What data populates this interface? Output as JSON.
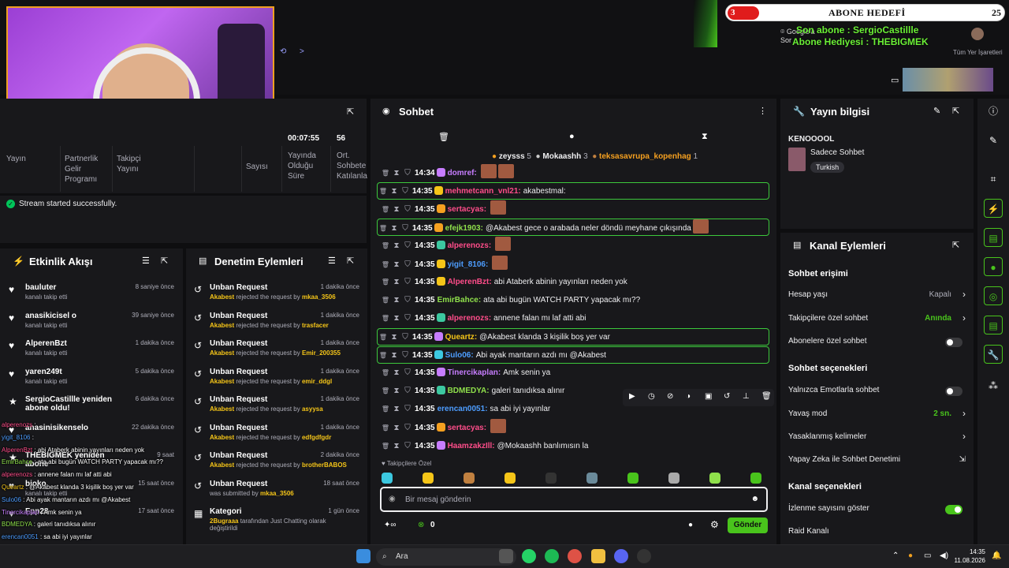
{
  "overlay": {
    "goal_current": "3",
    "goal_title": "ABONE HEDEFİ",
    "goal_target": "25",
    "last_sub": "Son abone : SergioCastillle",
    "gift_sub": "Abone Hediyesi : THEBIGMEK",
    "browser_search": "Google'a Sor",
    "bookmarks": "Tüm Yer İşaretleri"
  },
  "stats": {
    "partner_label": "Partnerlik Gelir Programı",
    "follow_label": "Takipçi Yayını",
    "live_label": "Yayında Olduğu Süre",
    "live_value": "00:07:55",
    "viewers_label": "Sayısı",
    "viewers_value": "56",
    "avg_label": "Ort. Sohbete Katılanla"
  },
  "notice": "Stream started successfully.",
  "activity": {
    "title": "Etkinlik Akışı",
    "items": [
      {
        "name": "bauluter",
        "sub": "kanalı takip etti",
        "time": "8 saniye önce"
      },
      {
        "name": "anasikicisel o",
        "sub": "kanalı takip etti",
        "time": "39 saniye önce"
      },
      {
        "name": "AlperenBzt",
        "sub": "kanalı takip etti",
        "time": "1 dakika önce"
      },
      {
        "name": "yaren249t",
        "sub": "kanalı takip etti",
        "time": "5 dakika önce"
      },
      {
        "name": "SergioCastillle yeniden abone oldu!",
        "sub": "",
        "time": "6 dakika önce"
      },
      {
        "name": "anasinisikenselo",
        "sub": "",
        "time": "22 dakika önce"
      },
      {
        "name": "THEBIGMEK yeniden abone",
        "sub": "",
        "time": "9 saat"
      },
      {
        "name": "bioko",
        "sub": "kanalı takip etti",
        "time": "15 saat önce"
      },
      {
        "name": "Fpp28",
        "sub": "",
        "time": "17 saat önce"
      }
    ]
  },
  "moderation": {
    "title": "Denetim Eylemleri",
    "items": [
      {
        "title": "Unban Request",
        "who": "Akabest",
        "text": "rejected the request by",
        "target": "mkaa_3506",
        "time": "1 dakika önce"
      },
      {
        "title": "Unban Request",
        "who": "Akabest",
        "text": "rejected the request by",
        "target": "trasfacer",
        "time": "1 dakika önce"
      },
      {
        "title": "Unban Request",
        "who": "Akabest",
        "text": "rejected the request by",
        "target": "Emir_200355",
        "time": "1 dakika önce"
      },
      {
        "title": "Unban Request",
        "who": "Akabest",
        "text": "rejected the request by",
        "target": "emir_ddgl",
        "time": "1 dakika önce"
      },
      {
        "title": "Unban Request",
        "who": "Akabest",
        "text": "rejected the request by",
        "target": "asyysa",
        "time": "1 dakika önce"
      },
      {
        "title": "Unban Request",
        "who": "Akabest",
        "text": "rejected the request by",
        "target": "edfgdfgdr",
        "time": "1 dakika önce"
      },
      {
        "title": "Unban Request",
        "who": "Akabest",
        "text": "rejected the request by",
        "target": "brotherBABOS",
        "time": "2 dakika önce"
      },
      {
        "title": "Unban Request",
        "who": "",
        "text": "was submitted by",
        "target": "mkaa_3506",
        "time": "18 saat önce"
      },
      {
        "title": "Kategori",
        "who": "2Bugraaa",
        "text": "tarafından Just Chatting olarak değiştirildi",
        "target": "",
        "time": "1 gün önce"
      }
    ]
  },
  "overlay_chat": [
    {
      "user": "alperenozs",
      "color": "#ff4d8a",
      "msg": ""
    },
    {
      "user": "yigit_8106",
      "color": "#4d9dff",
      "msg": ""
    },
    {
      "user": "AlperenBzt",
      "color": "#ff4d8a",
      "msg": "abi Atаberk abinin yayınları neden yok"
    },
    {
      "user": "EmirBahce",
      "color": "#8fe04b",
      "msg": "ata abi bugün WATCH PARTY yapacak mı??"
    },
    {
      "user": "alperenozs",
      "color": "#ff4d8a",
      "msg": "annene falan mı laf atti abi"
    },
    {
      "user": "Queartz",
      "color": "#f5c518",
      "msg": "@Akabest klanda 3 kişilik boş yer var"
    },
    {
      "user": "Sulo06",
      "color": "#4d9dff",
      "msg": "Abi ayak mantarın azdı mı @Akabest"
    },
    {
      "user": "Tinercikaplan",
      "color": "#c77dff",
      "msg": "Amk senin ya"
    },
    {
      "user": "BDMEDYA",
      "color": "#8fe04b",
      "msg": "galeri tanıdıksa alınır"
    },
    {
      "user": "erencan0051",
      "color": "#4d9dff",
      "msg": "sa abi iyi yayınlar"
    },
    {
      "user": "sertacyas",
      "color": "#ff4d8a",
      "msg": ""
    },
    {
      "user": "HaamzakzIll",
      "color": "#ff4d8a",
      "msg": "@Mokaashh banlımısın la"
    }
  ],
  "chat": {
    "title": "Sohbet",
    "top_users": [
      {
        "name": "zeysss",
        "count": "5"
      },
      {
        "name": "Mokaashh",
        "count": "3"
      },
      {
        "name": "teksasavrupa_kopenhag",
        "count": "1"
      }
    ],
    "messages": [
      {
        "time": "14:35",
        "user": "domref",
        "color": "#c77dff",
        "msg": "",
        "emotes": 2,
        "hl": false,
        "badge": "#c77dff"
      },
      {
        "time": "14:35",
        "user": "mehmetcann_vnl21",
        "color": "#ff4d8a",
        "msg": "akabestmal:",
        "emotes": 0,
        "hl": true,
        "badge": "#f5c518"
      },
      {
        "time": "14:35",
        "user": "sertacyas",
        "color": "#ff4d8a",
        "msg": "",
        "emotes": 1,
        "hl": false,
        "badge": "#f5a020"
      },
      {
        "time": "14:35",
        "user": "efejk1903",
        "color": "#8fe04b",
        "msg": "@Akabest gece o arabada neler döndü meyhane çıkışında",
        "emotes": 1,
        "hl": true,
        "badge": "#f5a020"
      },
      {
        "time": "14:35",
        "user": "alperenozs",
        "color": "#ff4d8a",
        "msg": "",
        "emotes": 1,
        "hl": false,
        "badge": "#3cc8a0"
      },
      {
        "time": "14:35",
        "user": "yigit_8106",
        "color": "#4d9dff",
        "msg": "",
        "emotes": 1,
        "hl": false,
        "badge": "#f5c518"
      },
      {
        "time": "14:35",
        "user": "AlperenBzt",
        "color": "#ff4d8a",
        "msg": "abi Ataberk abinin yayınları neden yok",
        "emotes": 0,
        "hl": false,
        "badge": "#f5c518"
      },
      {
        "time": "14:35",
        "user": "EmirBahce",
        "color": "#8fe04b",
        "msg": "ata abi bugün WATCH PARTY yapacak mı??",
        "emotes": 0,
        "hl": false,
        "badge": ""
      },
      {
        "time": "14:35",
        "user": "alperenozs",
        "color": "#ff4d8a",
        "msg": "annene falan mı laf atti abi",
        "emotes": 0,
        "hl": false,
        "badge": "#3cc8a0"
      },
      {
        "time": "14:35",
        "user": "Queartz",
        "color": "#f5c518",
        "msg": "@Akabest klanda 3 kişilik boş yer var",
        "emotes": 0,
        "hl": true,
        "badge": "#c77dff"
      },
      {
        "time": "14:35",
        "user": "Sulo06",
        "color": "#4d9dff",
        "msg": "Abi ayak mantarın azdı mı @Akabest",
        "emotes": 0,
        "hl": true,
        "badge": "#3cc8e0"
      },
      {
        "time": "14:35",
        "user": "Tinercikaplan",
        "color": "#c77dff",
        "msg": "Amk senin ya",
        "emotes": 0,
        "hl": false,
        "badge": "#c77dff"
      },
      {
        "time": "14:35",
        "user": "BDMEDYA",
        "color": "#8fe04b",
        "msg": "galeri tanıdıksa alınır",
        "emotes": 0,
        "hl": false,
        "badge": "#3cc8a0"
      },
      {
        "time": "14:35",
        "user": "erencan0051",
        "color": "#4d9dff",
        "msg": "sa abi iyi yayınlar",
        "emotes": 0,
        "hl": false,
        "badge": ""
      },
      {
        "time": "14:35",
        "user": "sertacyas",
        "color": "#ff4d8a",
        "msg": "",
        "emotes": 1,
        "hl": false,
        "badge": "#f5a020"
      },
      {
        "time": "14:35",
        "user": "HaamzakzIll",
        "color": "#ff4d8a",
        "msg": "@Mokaashh banlımısın la",
        "emotes": 0,
        "hl": false,
        "badge": "#c77dff"
      }
    ],
    "first_time": "14:34",
    "followers_label": "Takipçilere Özel",
    "input_placeholder": "Bir mesaj gönderin",
    "count": "0",
    "send_label": "Gönder"
  },
  "stream_info": {
    "title": "Yayın bilgisi",
    "name": "KENOOOOL",
    "category": "Sadece Sohbet",
    "tag": "Turkish"
  },
  "channel_actions": {
    "title": "Kanal Eylemleri",
    "chat_access": "Sohbet erişimi",
    "account_age": "Hesap yaşı",
    "account_age_val": "Kapalı",
    "followers_only": "Takipçilere özel sohbet",
    "followers_only_val": "Anında",
    "subs_only": "Abonelere özel sohbet",
    "chat_options": "Sohbet seçenekleri",
    "emote_only": "Yalnızca Emotlarla sohbet",
    "slow_mode": "Yavaş mod",
    "slow_mode_val": "2 sn.",
    "banned_words": "Yasaklanmış kelimeler",
    "ai_mod": "Yapay Zeka ile Sohbet Denetimi",
    "channel_options": "Kanal seçenekleri",
    "show_viewers": "İzlenme sayısını göster",
    "raid": "Raid Kanalı"
  },
  "taskbar": {
    "search": "Ara",
    "time": "14:35",
    "date": "11.08.2026"
  },
  "colors": {
    "accent": "#49c41c",
    "bg": "#0e0e10",
    "panel": "#18181b"
  }
}
